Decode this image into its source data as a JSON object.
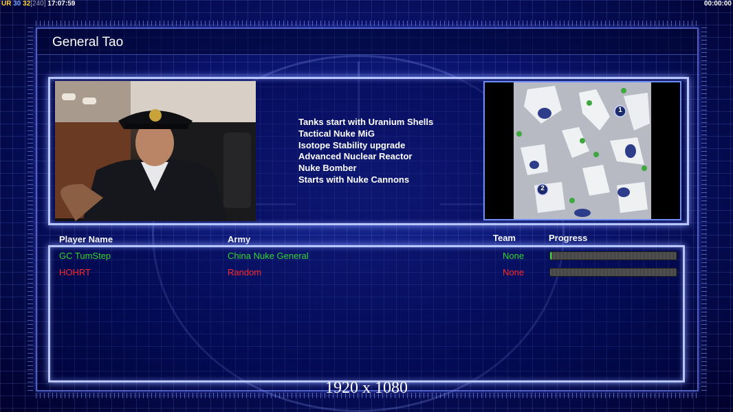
{
  "hud": {
    "ur_label": "UR",
    "val_30": "30",
    "val_32": "32",
    "val_240": "[240]",
    "clock": "17:07:59",
    "timer": "00:00:00"
  },
  "title": "General Tao",
  "bonuses": [
    "Tanks start with Uranium Shells",
    "Tactical Nuke MiG",
    "Isotope Stability upgrade",
    "Advanced Nuclear Reactor",
    "Nuke Bomber",
    "Starts with Nuke Cannons"
  ],
  "minimap": {
    "start_1": "1",
    "start_2": "2"
  },
  "table": {
    "headers": {
      "player_name": "Player Name",
      "army": "Army",
      "team": "Team",
      "progress": "Progress"
    },
    "rows": [
      {
        "name": "GC TumStep",
        "army": "China Nuke General",
        "team": "None",
        "progress": 0.01,
        "color": "#2fd82f"
      },
      {
        "name": "HOHRT",
        "army": "Random",
        "team": "None",
        "progress": 0,
        "color": "#ff2a2a"
      }
    ]
  },
  "resolution": "1920 x 1080",
  "colors": {
    "accent_frame": "#b7c6ff",
    "background": "#071056",
    "player1": "#2fd82f",
    "player2": "#ff2a2a"
  }
}
